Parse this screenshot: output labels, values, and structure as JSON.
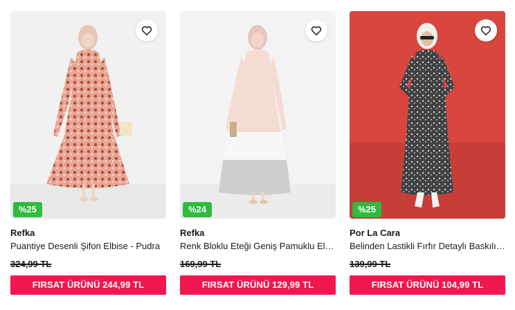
{
  "products": [
    {
      "brand": "Refka",
      "title": "Puantiye Desenli Şifon Elbise - Pudra",
      "discount_badge": "%25",
      "old_price": "324,99 TL",
      "deal_label": "FIRSAT ÜRÜNÜ",
      "deal_price": "244,99 TL",
      "image_icon": "model-floral-dress-image",
      "favorite_icon": "heart-outline-icon"
    },
    {
      "brand": "Refka",
      "title": "Renk Bloklu Eteği Geniş Pamuklu Elbise",
      "discount_badge": "%24",
      "old_price": "169,99 TL",
      "deal_label": "FIRSAT ÜRÜNÜ",
      "deal_price": "129,99 TL",
      "image_icon": "model-color-block-dress-image",
      "favorite_icon": "heart-outline-icon"
    },
    {
      "brand": "Por La Cara",
      "title": "Belinden Lastikli Fırfır Detaylı Baskılı Elbise",
      "discount_badge": "%25",
      "old_price": "139,99 TL",
      "deal_label": "FIRSAT ÜRÜNÜ",
      "deal_price": "104,99 TL",
      "image_icon": "model-printed-dress-image",
      "favorite_icon": "heart-outline-icon"
    }
  ],
  "colors": {
    "badge_green": "#2fbb3f",
    "deal_red": "#f2184f"
  }
}
